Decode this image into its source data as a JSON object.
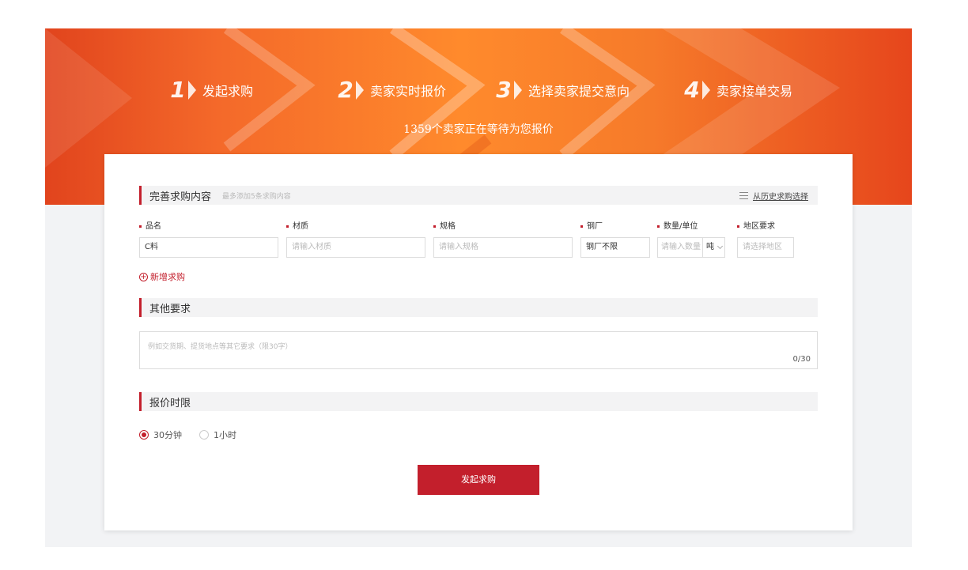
{
  "steps": [
    {
      "num": "1",
      "label": "发起求购"
    },
    {
      "num": "2",
      "label": "卖家实时报价"
    },
    {
      "num": "3",
      "label": "选择卖家提交意向"
    },
    {
      "num": "4",
      "label": "卖家接单交易"
    }
  ],
  "banner_subtitle": "1359个卖家正在等待为您报价",
  "purchase_section": {
    "title": "完善求购内容",
    "hint": "最多添加5条求购内容",
    "history_link": "从历史求购选择"
  },
  "fields": {
    "name": {
      "label": "品名",
      "value": "C料"
    },
    "material": {
      "label": "材质",
      "placeholder": "请输入材质"
    },
    "spec": {
      "label": "规格",
      "placeholder": "请输入规格"
    },
    "mill": {
      "label": "钢厂",
      "value": "钢厂不限"
    },
    "quantity": {
      "label": "数量/单位",
      "placeholder": "请输入数量",
      "unit": "吨"
    },
    "region": {
      "label": "地区要求",
      "placeholder": "请选择地区"
    }
  },
  "add_purchase": "新增求购",
  "other_section": {
    "title": "其他要求",
    "placeholder": "例如交货期、提货地点等其它要求（限30字）",
    "counter": "0/30"
  },
  "deadline_section": {
    "title": "报价时限",
    "options": [
      {
        "label": "30分钟",
        "checked": true
      },
      {
        "label": "1小时",
        "checked": false
      }
    ]
  },
  "submit_label": "发起求购",
  "colors": {
    "accent": "#c31f2c",
    "banner_orange": "#ff8a2c",
    "banner_red": "#e1441d"
  }
}
